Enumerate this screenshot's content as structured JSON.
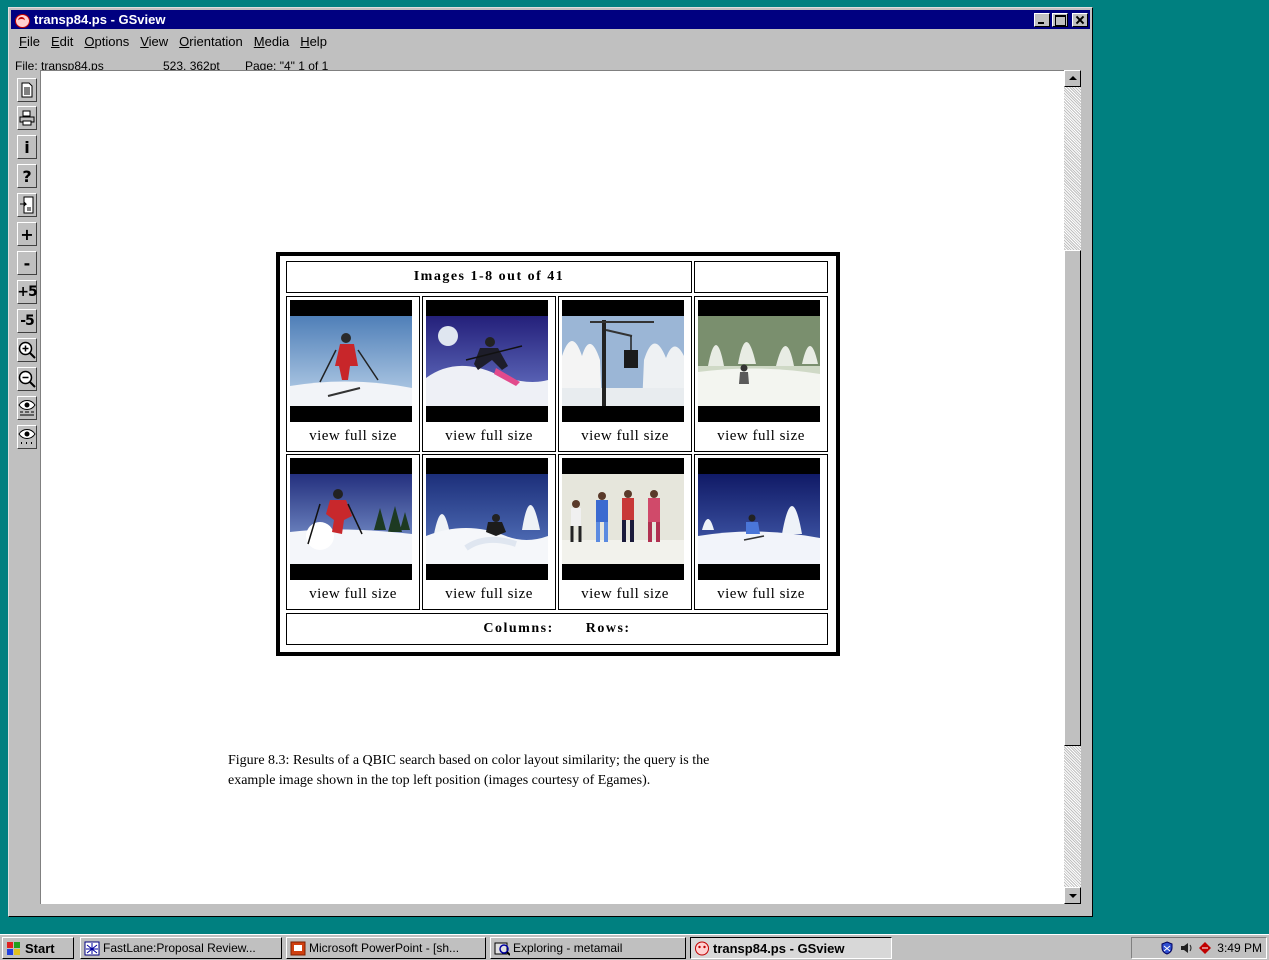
{
  "window": {
    "title": "transp84.ps - GSview"
  },
  "menu": {
    "file": {
      "u": "F",
      "rest": "ile"
    },
    "edit": {
      "u": "E",
      "rest": "dit"
    },
    "options": {
      "u": "O",
      "rest": "ptions"
    },
    "view": {
      "u": "V",
      "rest": "iew"
    },
    "orientation": {
      "u": "O",
      "rest": "rientation"
    },
    "media": {
      "u": "M",
      "rest": "edia"
    },
    "help": {
      "u": "H",
      "rest": "elp"
    }
  },
  "status": {
    "file": "File: transp84.ps",
    "coords": "523, 362pt",
    "page": "Page: \"4\"  1 of 1"
  },
  "toolbar": {
    "open": "open-document-icon",
    "print": "print-icon",
    "info": "i",
    "help": "?",
    "goto_page": "goto-page-icon",
    "next": "+",
    "prev": "-",
    "skip_forward": "+5",
    "skip_back": "-5",
    "zoom_in": "zoom-in-icon",
    "zoom_out": "zoom-out-icon",
    "text_view": "eye-text-icon",
    "dots_view": "eye-dots-icon"
  },
  "document": {
    "header": "Images 1-8 out of 41",
    "link_label": "view full size",
    "columns_label": "Columns:",
    "rows_label": "Rows:",
    "caption_line1": "Figure 8.3: Results of a QBIC search based on color layout similarity; the query is the",
    "caption_line2": "example image shown in the top left position (images courtesy of Egames)."
  },
  "taskbar": {
    "start": "Start",
    "items": [
      "FastLane:Proposal Review...",
      "Microsoft PowerPoint - [sh...",
      "Exploring - metamail",
      "transp84.ps - GSview"
    ],
    "clock": "3:49 PM"
  },
  "colors": {
    "desktop": "#008080",
    "titlebar": "#000080",
    "chrome": "#c0c0c0"
  }
}
